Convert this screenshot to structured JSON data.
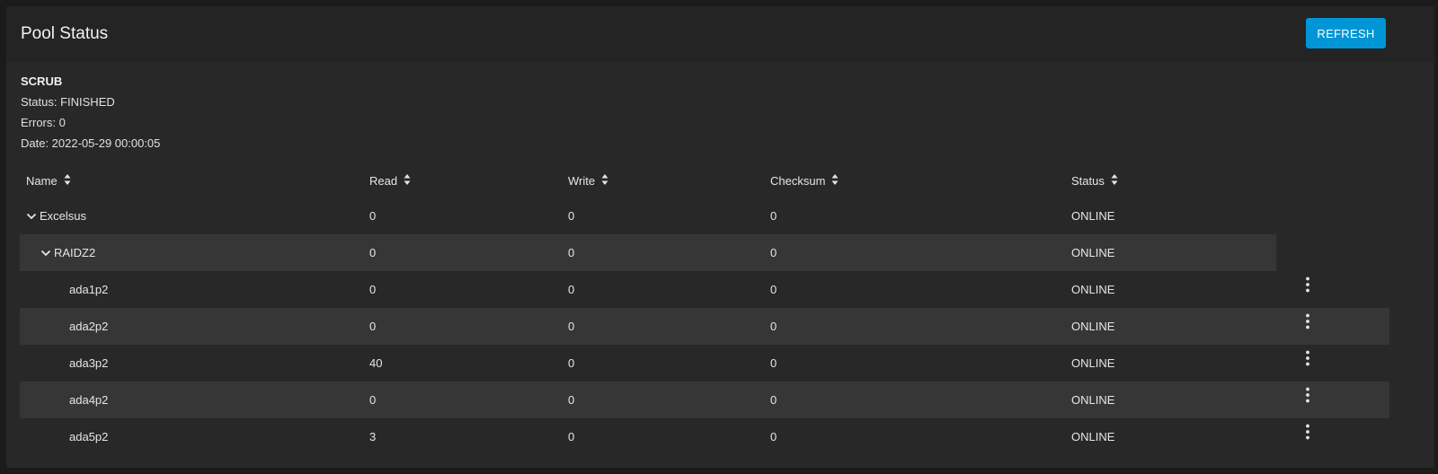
{
  "card": {
    "title": "Pool Status",
    "refresh_label": "REFRESH"
  },
  "scrub": {
    "heading": "SCRUB",
    "status": "Status: FINISHED",
    "errors": "Errors: 0",
    "date": "Date: 2022-05-29 00:00:05"
  },
  "table": {
    "columns": [
      "Name",
      "Read",
      "Write",
      "Checksum",
      "Status"
    ],
    "rows": [
      {
        "name": "Excelsus",
        "read": "0",
        "write": "0",
        "checksum": "0",
        "status": "ONLINE"
      },
      {
        "name": "RAIDZ2",
        "read": "0",
        "write": "0",
        "checksum": "0",
        "status": "ONLINE"
      },
      {
        "name": "ada1p2",
        "read": "0",
        "write": "0",
        "checksum": "0",
        "status": "ONLINE"
      },
      {
        "name": "ada2p2",
        "read": "0",
        "write": "0",
        "checksum": "0",
        "status": "ONLINE"
      },
      {
        "name": "ada3p2",
        "read": "40",
        "write": "0",
        "checksum": "0",
        "status": "ONLINE"
      },
      {
        "name": "ada4p2",
        "read": "0",
        "write": "0",
        "checksum": "0",
        "status": "ONLINE"
      },
      {
        "name": "ada5p2",
        "read": "3",
        "write": "0",
        "checksum": "0",
        "status": "ONLINE"
      }
    ]
  },
  "icons": {
    "sort": "sort-icon",
    "expand": "chevron-down-icon",
    "actions": "more-vert-icon"
  },
  "colors": {
    "accent": "#0095d5",
    "background": "#1b1b1b",
    "card": "#282828",
    "row_shade": "#363636"
  }
}
